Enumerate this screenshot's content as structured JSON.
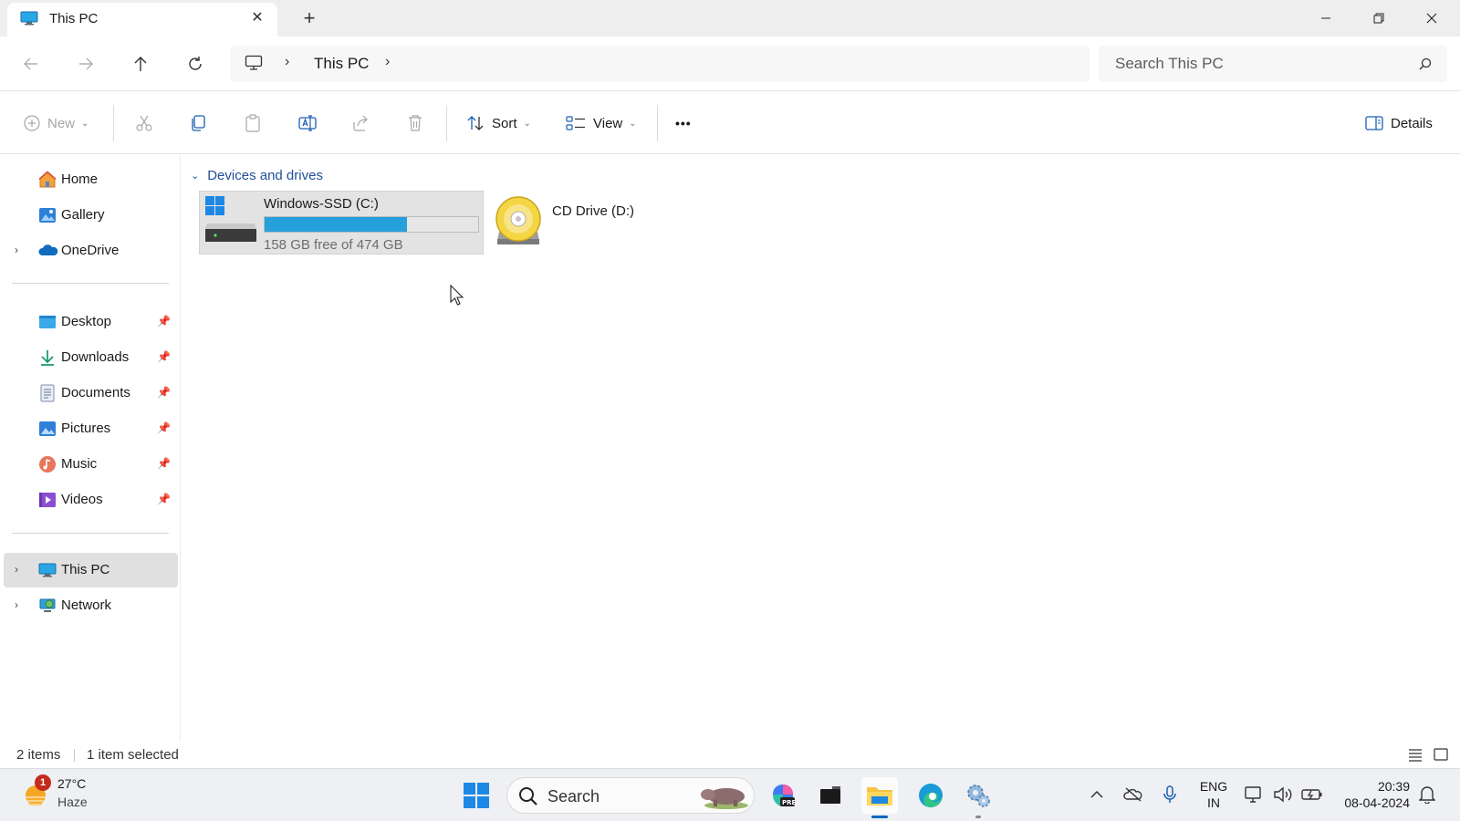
{
  "window": {
    "tab_title": "This PC",
    "tab_close_glyph": "✕",
    "new_tab_glyph": "+",
    "minimize_glyph": "—",
    "close_glyph": "✕"
  },
  "address": {
    "crumb": "This PC",
    "search_placeholder": "Search This PC"
  },
  "commands": {
    "new_label": "New",
    "sort_label": "Sort",
    "view_label": "View",
    "more_glyph": "•••",
    "details_label": "Details"
  },
  "sidebar": {
    "items": [
      {
        "label": "Home",
        "icon": "home-icon"
      },
      {
        "label": "Gallery",
        "icon": "gallery-icon"
      },
      {
        "label": "OneDrive",
        "icon": "onedrive-icon"
      },
      {
        "label": "Desktop",
        "icon": "desktop-folder-icon"
      },
      {
        "label": "Downloads",
        "icon": "downloads-icon"
      },
      {
        "label": "Documents",
        "icon": "documents-icon"
      },
      {
        "label": "Pictures",
        "icon": "pictures-icon"
      },
      {
        "label": "Music",
        "icon": "music-icon"
      },
      {
        "label": "Videos",
        "icon": "videos-icon"
      },
      {
        "label": "This PC",
        "icon": "this-pc-icon"
      },
      {
        "label": "Network",
        "icon": "network-icon"
      }
    ]
  },
  "content": {
    "group_header": "Devices and drives",
    "drives": [
      {
        "name": "Windows-SSD (C:)",
        "free_text": "158 GB free of 474 GB",
        "used_fraction": 0.667
      },
      {
        "name": "CD Drive (D:)"
      }
    ]
  },
  "status": {
    "item_count": "2 items",
    "selection": "1 item selected"
  },
  "taskbar": {
    "weather_temp": "27°C",
    "weather_condition": "Haze",
    "weather_badge": "1",
    "search_label": "Search",
    "lang_line1": "ENG",
    "lang_line2": "IN",
    "time": "20:39",
    "date": "08-04-2024"
  },
  "colors": {
    "accent": "#0067c0",
    "drive_bar": "#26a0da",
    "selection_bg": "#e3e3e3",
    "group_header": "#1f4e99"
  }
}
